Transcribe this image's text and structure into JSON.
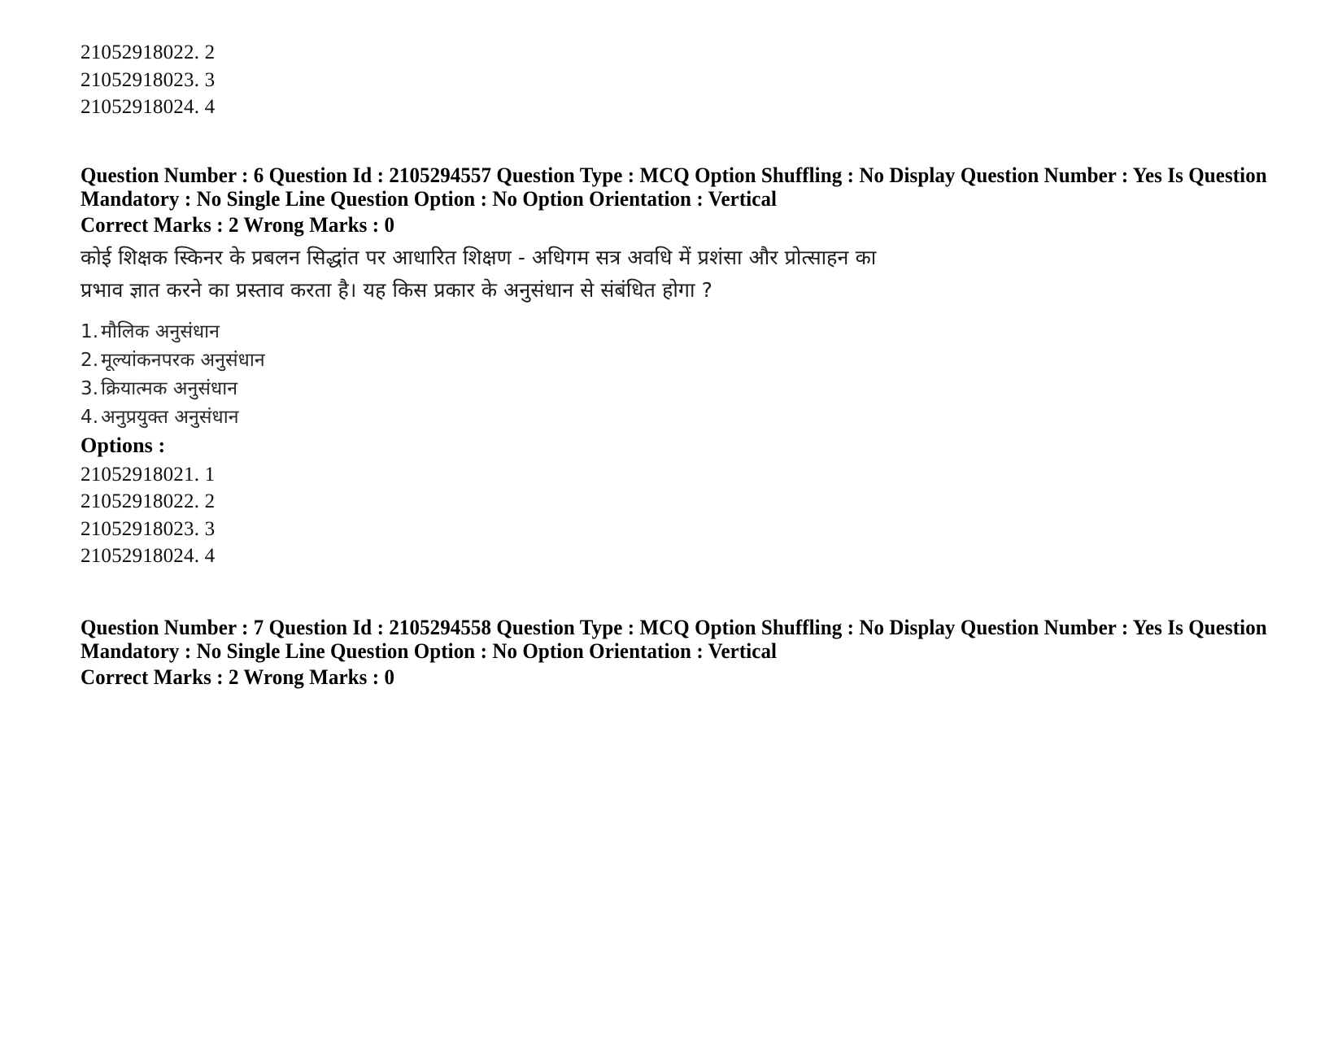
{
  "document": {
    "page_background": "#ffffff",
    "text_color": "#000000"
  },
  "top_option_ids": [
    "21052918022. 2",
    "21052918023. 3",
    "21052918024. 4"
  ],
  "question6": {
    "meta_line1": "Question Number : 6 Question Id : 2105294557 Question Type : MCQ Option Shuffling : No Display Question Number : Yes Is Question",
    "meta_line2": "Mandatory : No Single Line Question Option : No Option Orientation : Vertical",
    "marks_line": "Correct Marks : 2 Wrong Marks : 0",
    "question_text_line1": "कोई शिक्षक स्किनर के प्रबलन सिद्धांत पर आधारित शिक्षण - अधिगम सत्र अवधि में प्रशंसा और प्रोत्साहन का",
    "question_text_line2": "प्रभाव ज्ञात करने का प्रस्ताव करता है। यह किस प्रकार के अनुसंधान से संबंधित होगा ?",
    "choices": [
      {
        "num": "1.",
        "text": "मौलिक अनुसंधान"
      },
      {
        "num": "2.",
        "text": "मूल्यांकनपरक अनुसंधान"
      },
      {
        "num": "3.",
        "text": "क्रियात्मक अनुसंधान"
      },
      {
        "num": "4.",
        "text": "अनुप्रयुक्त अनुसंधान"
      }
    ],
    "options_label": "Options :",
    "option_ids": [
      "21052918021. 1",
      "21052918022. 2",
      "21052918023. 3",
      "21052918024. 4"
    ]
  },
  "question7": {
    "meta_line1": "Question Number : 7 Question Id : 2105294558 Question Type : MCQ Option Shuffling : No Display Question Number : Yes Is Question",
    "meta_line2": "Mandatory : No Single Line Question Option : No Option Orientation : Vertical",
    "marks_line": "Correct Marks : 2 Wrong Marks : 0"
  }
}
